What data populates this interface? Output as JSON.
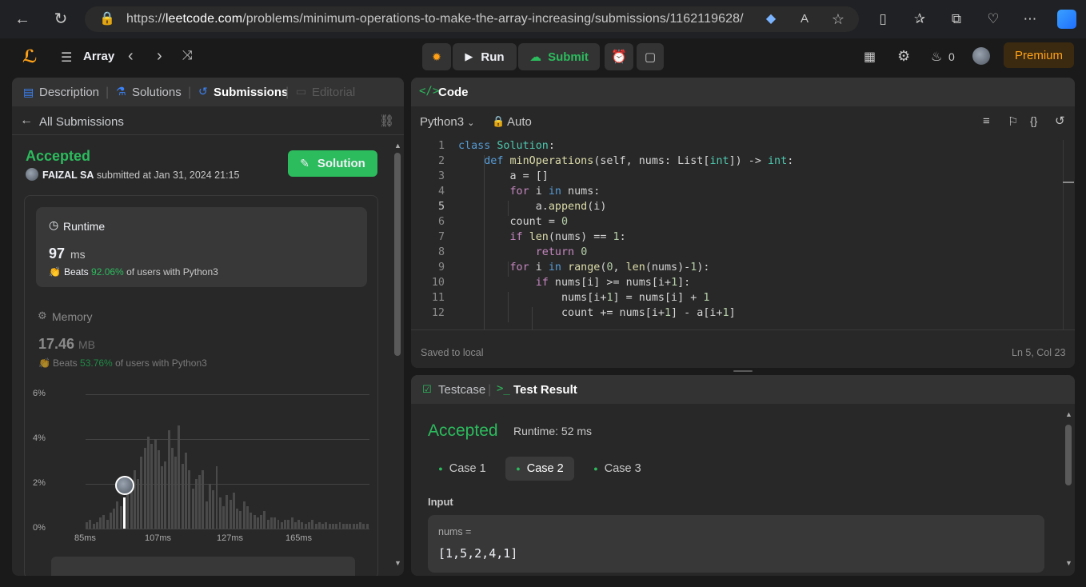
{
  "browser": {
    "url_prefix": "https://",
    "url_domain": "leetcode.com",
    "url_path": "/problems/minimum-operations-to-make-the-array-increasing/submissions/1162119628/"
  },
  "topbar": {
    "problem_list": "Array",
    "run_label": "Run",
    "submit_label": "Submit",
    "streak": "0",
    "premium_label": "Premium"
  },
  "left": {
    "tabs": [
      "Description",
      "Solutions",
      "Submissions",
      "Editorial"
    ],
    "back_label": "All Submissions",
    "status": "Accepted",
    "user": "FAIZAL SA",
    "submitted_text": "submitted at Jan 31, 2024 21:15",
    "solution_btn": "Solution",
    "runtime": {
      "title": "Runtime",
      "value": "97",
      "unit": "ms",
      "beats_label": "Beats",
      "beats_pct": "92.06%",
      "beats_suffix": "of users with Python3"
    },
    "memory": {
      "title": "Memory",
      "value": "17.46",
      "unit": "MB",
      "beats_label": "Beats",
      "beats_pct": "53.76%",
      "beats_suffix": "of users with Python3"
    }
  },
  "chart_data": {
    "type": "bar",
    "y_ticks": [
      "6%",
      "4%",
      "2%",
      "0%"
    ],
    "x_ticks": [
      "85ms",
      "107ms",
      "127ms",
      "165ms"
    ],
    "ylim": [
      0,
      6
    ],
    "values": [
      0.3,
      0.4,
      0.2,
      0.3,
      0.5,
      0.6,
      0.4,
      0.7,
      0.9,
      1.2,
      1.0,
      1.4,
      1.8,
      2.0,
      2.6,
      2.2,
      3.2,
      3.6,
      4.1,
      3.8,
      4.0,
      3.5,
      2.8,
      3.0,
      4.4,
      3.6,
      3.2,
      4.6,
      2.9,
      3.4,
      2.6,
      1.8,
      2.2,
      2.4,
      2.6,
      1.2,
      2.0,
      1.7,
      2.8,
      1.4,
      1.0,
      1.5,
      1.3,
      1.6,
      0.9,
      0.8,
      1.2,
      1.0,
      0.7,
      0.6,
      0.5,
      0.6,
      0.8,
      0.4,
      0.5,
      0.5,
      0.4,
      0.3,
      0.4,
      0.4,
      0.5,
      0.3,
      0.4,
      0.3,
      0.2,
      0.3,
      0.4,
      0.2,
      0.3,
      0.2,
      0.3,
      0.2,
      0.2,
      0.2,
      0.3,
      0.2,
      0.2,
      0.2,
      0.2,
      0.2,
      0.3,
      0.2,
      0.2
    ],
    "highlight_index": 11
  },
  "editor": {
    "title": "Code",
    "language": "Python3",
    "mode": "Auto",
    "footer_saved": "Saved to local",
    "footer_pos": "Ln 5, Col 23",
    "lines": [
      {
        "n": "1",
        "html": "<span class=\"kw\">class</span> <span class=\"cls\">Solution</span>:"
      },
      {
        "n": "2",
        "html": "    <span class=\"kw\">def</span> <span class=\"fn\">minOperations</span>(self, nums: List[<span class=\"cls\">int</span>]) -> <span class=\"cls\">int</span>:"
      },
      {
        "n": "3",
        "html": "        a = []"
      },
      {
        "n": "4",
        "html": "        <span class=\"kw2\">for</span> i <span class=\"kw\">in</span> nums:"
      },
      {
        "n": "5",
        "html": "            a.<span class=\"fn\">append</span>(i)"
      },
      {
        "n": "6",
        "html": "        count = <span class=\"num\">0</span>"
      },
      {
        "n": "7",
        "html": "        <span class=\"kw2\">if</span> <span class=\"fn\">len</span>(nums) == <span class=\"num\">1</span>:"
      },
      {
        "n": "8",
        "html": "            <span class=\"kw2\">return</span> <span class=\"num\">0</span>"
      },
      {
        "n": "9",
        "html": "        <span class=\"kw2\">for</span> i <span class=\"kw\">in</span> <span class=\"fn\">range</span>(<span class=\"num\">0</span>, <span class=\"fn\">len</span>(nums)-<span class=\"num\">1</span>):"
      },
      {
        "n": "10",
        "html": "            <span class=\"kw2\">if</span> nums[i] >= nums[i+<span class=\"num\">1</span>]:"
      },
      {
        "n": "11",
        "html": "                nums[i+<span class=\"num\">1</span>] = nums[i] + <span class=\"num\">1</span>"
      },
      {
        "n": "12",
        "html": "                count += nums[i+<span class=\"num\">1</span>] - a[i+<span class=\"num\">1</span>]"
      }
    ]
  },
  "result": {
    "tab_testcase": "Testcase",
    "tab_result": "Test Result",
    "status": "Accepted",
    "runtime_text": "Runtime: 52 ms",
    "cases": [
      "Case 1",
      "Case 2",
      "Case 3"
    ],
    "input_label": "Input",
    "var_name": "nums =",
    "var_value": "[1,5,2,4,1]"
  }
}
